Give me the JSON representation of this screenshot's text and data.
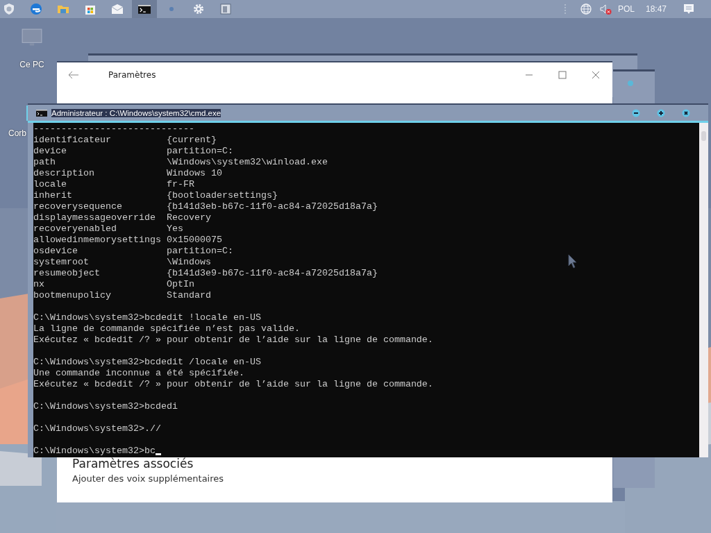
{
  "taskbar": {
    "language": "POL",
    "clock": "18:47"
  },
  "desktop_icons": [
    {
      "label": "Ce PC"
    },
    {
      "label": "Corb"
    }
  ],
  "settings_window": {
    "title": "Paramètres",
    "section_heading": "Paramètres associés",
    "link": "Ajouter des voix supplémentaires"
  },
  "console_window": {
    "title": "Administrateur : C:\\Windows\\system32\\cmd.exe",
    "blocks": [
      [
        "-----------------------------",
        "identificateur          {current}",
        "device                  partition=C:",
        "path                    \\Windows\\system32\\winload.exe",
        "description             Windows 10",
        "locale                  fr-FR",
        "inherit                 {bootloadersettings}",
        "recoverysequence        {b141d3eb-b67c-11f0-ac84-a72025d18a7a}",
        "displaymessageoverride  Recovery",
        "recoveryenabled         Yes",
        "allowedinmemorysettings 0x15000075",
        "osdevice                partition=C:",
        "systemroot              \\Windows",
        "resumeobject            {b141d3e9-b67c-11f0-ac84-a72025d18a7a}",
        "nx                      OptIn",
        "bootmenupolicy          Standard"
      ],
      [
        "C:\\Windows\\system32>bcdedit !locale en-US",
        "La ligne de commande spécifiée n’est pas valide.",
        "Exécutez « bcdedit /? » pour obtenir de l’aide sur la ligne de commande."
      ],
      [
        "C:\\Windows\\system32>bcdedit /locale en-US",
        "Une commande inconnue a été spécifiée.",
        "Exécutez « bcdedit /? » pour obtenir de l’aide sur la ligne de commande."
      ],
      [
        "C:\\Windows\\system32>bcdedi"
      ],
      [
        "C:\\Windows\\system32>.//"
      ],
      [
        "C:\\Windows\\system32>bc"
      ]
    ]
  }
}
